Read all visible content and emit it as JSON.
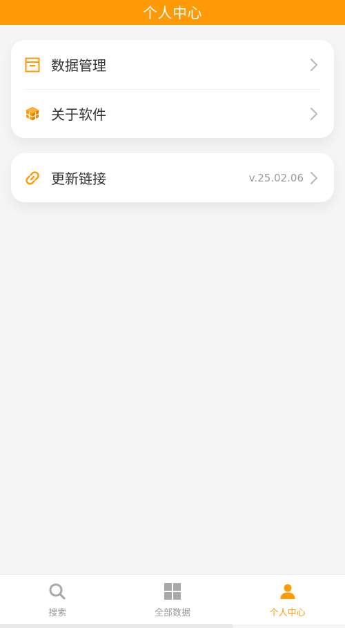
{
  "header": {
    "title": "个人中心"
  },
  "menu_group_1": [
    {
      "label": "数据管理",
      "icon": "archive-box-icon"
    },
    {
      "label": "关于软件",
      "icon": "cube-icon"
    }
  ],
  "menu_group_2": [
    {
      "label": "更新链接",
      "icon": "link-icon",
      "value": "v.25.02.06"
    }
  ],
  "tabbar": [
    {
      "label": "搜索",
      "icon": "search-icon",
      "active": false
    },
    {
      "label": "全部数据",
      "icon": "grid-icon",
      "active": false
    },
    {
      "label": "个人中心",
      "icon": "person-icon",
      "active": true
    }
  ],
  "colors": {
    "accent": "#ff9a06",
    "background": "#f5f5f5",
    "text": "#333333",
    "muted": "#9a9a9a"
  }
}
